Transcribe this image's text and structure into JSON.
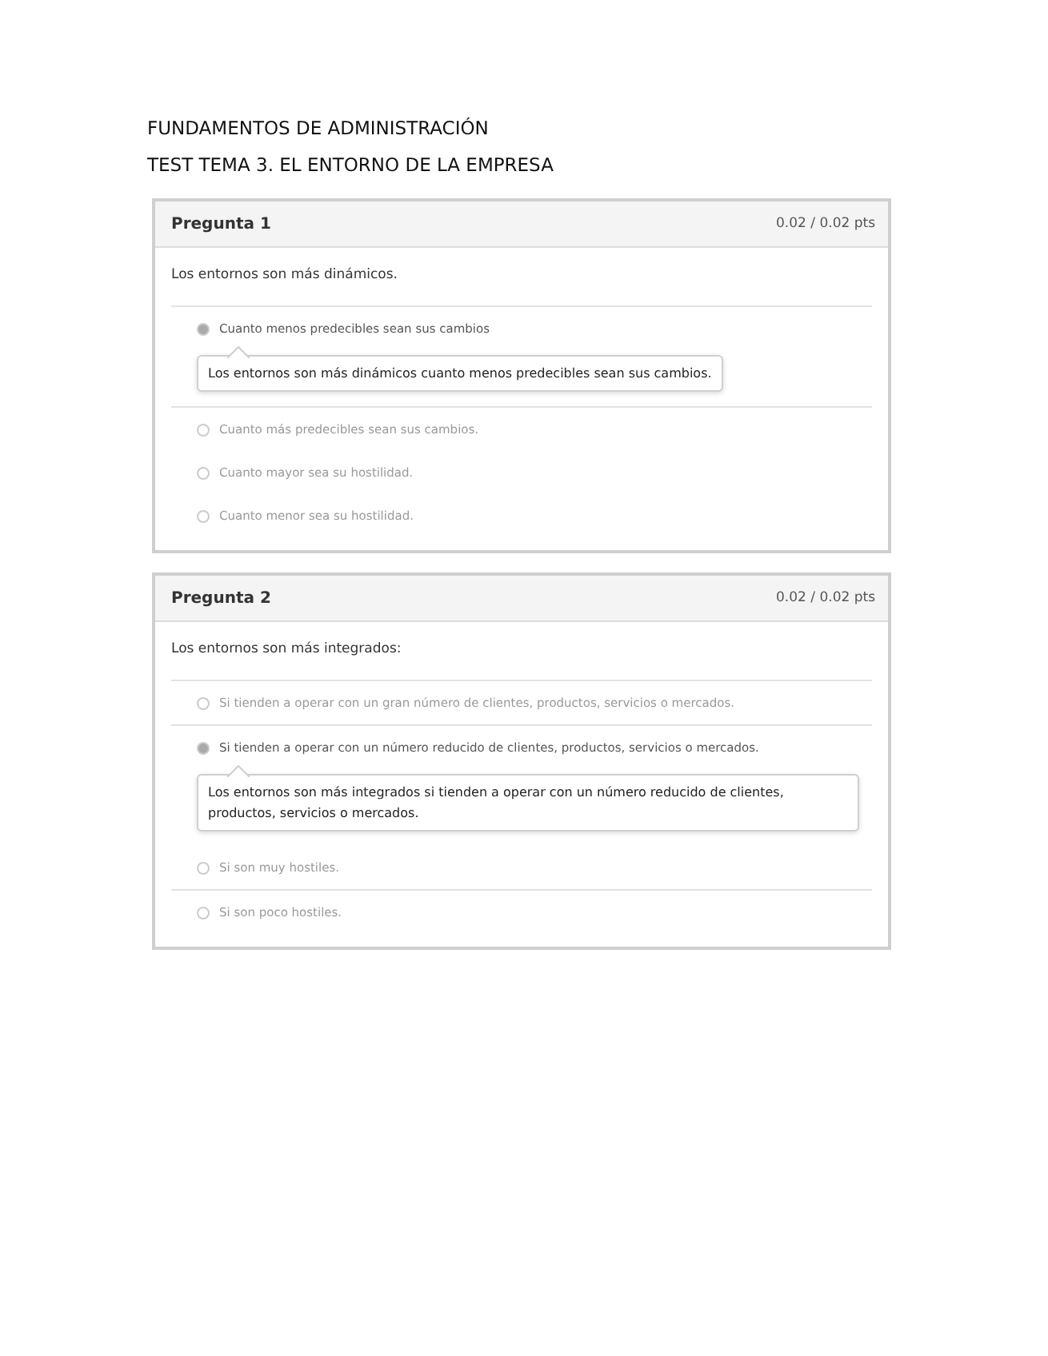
{
  "document": {
    "title": "FUNDAMENTOS DE ADMINISTRACIÓN",
    "subtitle": "TEST TEMA 3. EL ENTORNO DE LA EMPRESA"
  },
  "questions": [
    {
      "title": "Pregunta 1",
      "score": "0.02 / 0.02 pts",
      "prompt": "Los entornos son más dinámicos.",
      "answers": [
        {
          "text": "Cuanto menos predecibles sean sus cambios",
          "selected": true,
          "divider": true,
          "comment": "Los entornos son más dinámicos cuanto menos predecibles sean sus cambios."
        },
        {
          "text": "Cuanto más predecibles sean sus cambios.",
          "selected": false,
          "divider": false
        },
        {
          "text": "Cuanto mayor sea su hostilidad.",
          "selected": false,
          "divider": false
        },
        {
          "text": "Cuanto menor sea su hostilidad.",
          "selected": false,
          "divider": false
        }
      ]
    },
    {
      "title": "Pregunta 2",
      "score": "0.02 / 0.02 pts",
      "prompt": "Los entornos son más integrados:",
      "answers": [
        {
          "text": "Si tienden a operar con un gran número de clientes, productos, servicios o mercados.",
          "selected": false,
          "divider": true
        },
        {
          "text": "Si tienden a operar con un número reducido de clientes, productos, servicios o mercados.",
          "selected": true,
          "divider": false,
          "comment": "Los entornos son más integrados si tienden a operar con un número reducido de clientes, productos, servicios o mercados."
        },
        {
          "text": "Si son muy hostiles.",
          "selected": false,
          "divider": true
        },
        {
          "text": "Si son poco hostiles.",
          "selected": false,
          "divider": false
        }
      ]
    }
  ]
}
